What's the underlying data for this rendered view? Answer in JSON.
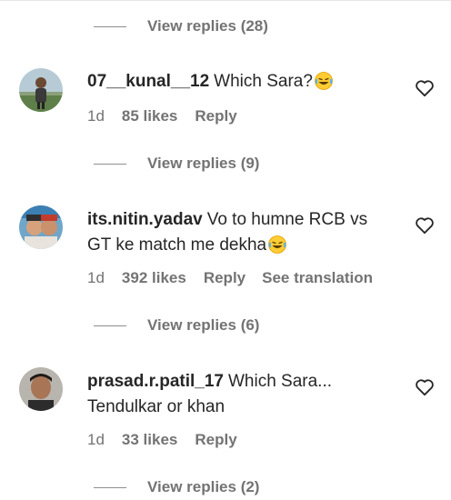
{
  "replies_toggle_top": {
    "label": "View replies (28)"
  },
  "comments": [
    {
      "username": "07__kunal__12",
      "text": "Which Sara?",
      "time": "1d",
      "likes": "85 likes",
      "reply_label": "Reply",
      "view_replies": "View replies (9)"
    },
    {
      "username": "its.nitin.yadav",
      "text": "Vo to humne RCB vs GT ke match me dekha",
      "time": "1d",
      "likes": "392 likes",
      "reply_label": "Reply",
      "translation_label": "See translation",
      "view_replies": "View replies (6)"
    },
    {
      "username": "prasad.r.patil_17",
      "text": "Which Sara... Tendulkar or khan",
      "time": "1d",
      "likes": "33 likes",
      "reply_label": "Reply",
      "view_replies": "View replies (2)"
    }
  ],
  "icons": {
    "like": "heart-outline-icon",
    "emoji": "face-with-tears-of-joy"
  },
  "colors": {
    "text": "#262626",
    "secondary": "#737373",
    "background": "#ffffff"
  }
}
